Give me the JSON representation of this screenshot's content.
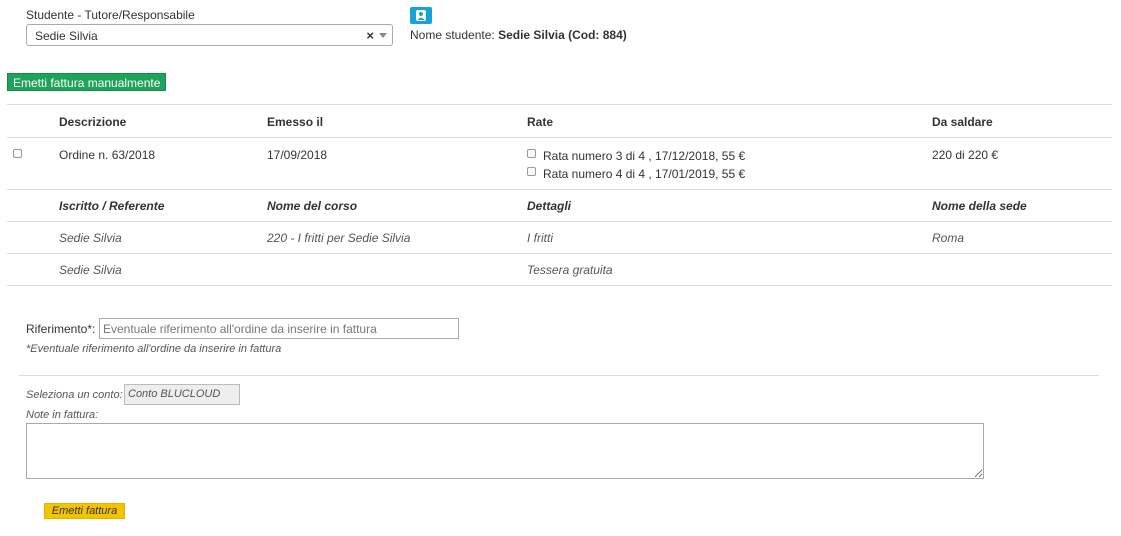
{
  "student_select": {
    "label": "Studente - Tutore/Responsabile",
    "value": "Sedie Silvia",
    "clear_glyph": "×"
  },
  "student_info": {
    "prefix": "Nome studente:",
    "name": "Sedie Silvia (Cod: 884)"
  },
  "manual_invoice_button": "Emetti fattura manualmente",
  "orders_table": {
    "headers": [
      "Descrizione",
      "Emesso il",
      "Rate",
      "Da saldare"
    ],
    "row": {
      "description": "Ordine n. 63/2018",
      "issued": "17/09/2018",
      "installments": [
        "Rata numero 3 di 4 , 17/12/2018, 55 €",
        "Rata numero 4 di 4 , 17/01/2019, 55 €"
      ],
      "due": "220 di 220 €"
    }
  },
  "details_table": {
    "headers": [
      "Iscritto / Referente",
      "Nome del corso",
      "Dettagli",
      "Nome della sede"
    ],
    "rows": [
      [
        "Sedie Silvia",
        "220 - I fritti per Sedie Silvia",
        "I fritti",
        "Roma"
      ],
      [
        "Sedie Silvia",
        "",
        "Tessera gratuita",
        ""
      ]
    ]
  },
  "reference": {
    "label": "Riferimento*:",
    "placeholder": "Eventuale riferimento all'ordine da inserire in fattura",
    "note": "*Eventuale riferimento all'ordine da inserire in fattura"
  },
  "account": {
    "label": "Seleziona un conto:",
    "value": "Conto BLUCLOUD"
  },
  "notes": {
    "label": "Note in fattura:"
  },
  "submit_button": "Emetti fattura",
  "colors": {
    "green_button": "#1fa35a",
    "yellow_button": "#f5c400",
    "user_icon_button": "#17a2d8"
  }
}
